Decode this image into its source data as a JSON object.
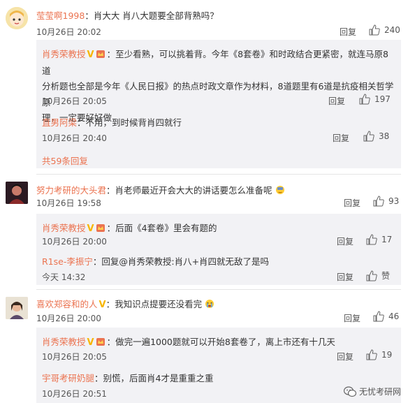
{
  "threads": [
    {
      "user": "莹莹啊1998",
      "text": "：肖大大 肖八大题要全部背熟吗？",
      "date": "10月26日 20:02",
      "reply_label": "回复",
      "likes": "240",
      "replies": [
        {
          "user": "肖秀荣教授",
          "text_lines": [
            "：至少看熟，可以挑着背。今年《8套卷》和时政结合更紧密，就连马原8道",
            "分析题也全部是今年《人民日报》的热点时政文章作为材料，8道题里有6道是抗疫相关哲学原",
            "理，一定要好好做"
          ],
          "date": "10月26日 20:05",
          "reply_label": "回复",
          "likes": "197"
        },
        {
          "user": "直男阿梁",
          "text": "：不用，到时候背肖四就行",
          "date": "10月26日 20:40",
          "reply_label": "回复",
          "likes": "38"
        }
      ],
      "more": "共59条回复"
    },
    {
      "user": "努力考研的大头君",
      "text": "：肖老师最近开会大大的讲话要怎么准备呢",
      "date": "10月26日 19:58",
      "reply_label": "回复",
      "likes": "93",
      "replies": [
        {
          "user": "肖秀荣教授",
          "text": "：后面《4套卷》里会有题的",
          "date": "10月26日 20:00",
          "reply_label": "回复",
          "likes": "17"
        },
        {
          "user": "R1se-李振宁",
          "text": "：回复@肖秀荣教授:肖八+肖四就无敌了是吗",
          "date": "今天 14:32",
          "reply_label": "回复",
          "likes": "赞"
        }
      ]
    },
    {
      "user": "喜欢郑容和的人",
      "text": "：我知识点提要还没看完",
      "date": "10月26日 20:00",
      "reply_label": "回复",
      "likes": "46",
      "replies": [
        {
          "user": "肖秀荣教授",
          "text": "：做完一遍1000题就可以开始8套卷了，离上市还有十几天",
          "date": "10月26日 20:05",
          "reply_label": "回复",
          "likes": "19"
        },
        {
          "user": "宇哥考研奶腿",
          "text": "：别慌，后面肖4才是重重之重",
          "date": "10月26日 20:51",
          "reply_label": "回复",
          "likes": ""
        }
      ]
    }
  ],
  "verified_badge": "V",
  "watermark": "无忧考研网",
  "colors": {
    "username": "#eb7350",
    "reply_bg": "#f2f2f5",
    "badge": "#f7b500"
  }
}
